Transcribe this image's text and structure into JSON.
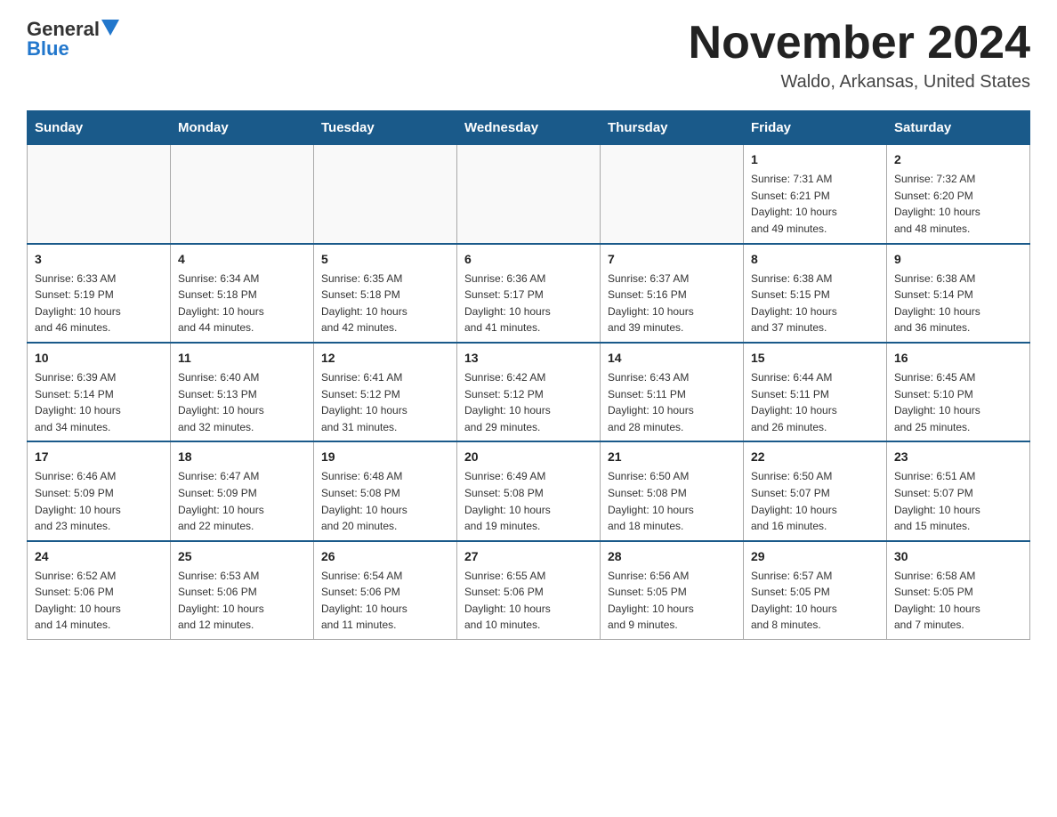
{
  "header": {
    "logo_general": "General",
    "logo_blue": "Blue",
    "main_title": "November 2024",
    "subtitle": "Waldo, Arkansas, United States"
  },
  "days_of_week": [
    "Sunday",
    "Monday",
    "Tuesday",
    "Wednesday",
    "Thursday",
    "Friday",
    "Saturday"
  ],
  "weeks": [
    {
      "days": [
        {
          "number": "",
          "info": ""
        },
        {
          "number": "",
          "info": ""
        },
        {
          "number": "",
          "info": ""
        },
        {
          "number": "",
          "info": ""
        },
        {
          "number": "",
          "info": ""
        },
        {
          "number": "1",
          "info": "Sunrise: 7:31 AM\nSunset: 6:21 PM\nDaylight: 10 hours\nand 49 minutes."
        },
        {
          "number": "2",
          "info": "Sunrise: 7:32 AM\nSunset: 6:20 PM\nDaylight: 10 hours\nand 48 minutes."
        }
      ]
    },
    {
      "days": [
        {
          "number": "3",
          "info": "Sunrise: 6:33 AM\nSunset: 5:19 PM\nDaylight: 10 hours\nand 46 minutes."
        },
        {
          "number": "4",
          "info": "Sunrise: 6:34 AM\nSunset: 5:18 PM\nDaylight: 10 hours\nand 44 minutes."
        },
        {
          "number": "5",
          "info": "Sunrise: 6:35 AM\nSunset: 5:18 PM\nDaylight: 10 hours\nand 42 minutes."
        },
        {
          "number": "6",
          "info": "Sunrise: 6:36 AM\nSunset: 5:17 PM\nDaylight: 10 hours\nand 41 minutes."
        },
        {
          "number": "7",
          "info": "Sunrise: 6:37 AM\nSunset: 5:16 PM\nDaylight: 10 hours\nand 39 minutes."
        },
        {
          "number": "8",
          "info": "Sunrise: 6:38 AM\nSunset: 5:15 PM\nDaylight: 10 hours\nand 37 minutes."
        },
        {
          "number": "9",
          "info": "Sunrise: 6:38 AM\nSunset: 5:14 PM\nDaylight: 10 hours\nand 36 minutes."
        }
      ]
    },
    {
      "days": [
        {
          "number": "10",
          "info": "Sunrise: 6:39 AM\nSunset: 5:14 PM\nDaylight: 10 hours\nand 34 minutes."
        },
        {
          "number": "11",
          "info": "Sunrise: 6:40 AM\nSunset: 5:13 PM\nDaylight: 10 hours\nand 32 minutes."
        },
        {
          "number": "12",
          "info": "Sunrise: 6:41 AM\nSunset: 5:12 PM\nDaylight: 10 hours\nand 31 minutes."
        },
        {
          "number": "13",
          "info": "Sunrise: 6:42 AM\nSunset: 5:12 PM\nDaylight: 10 hours\nand 29 minutes."
        },
        {
          "number": "14",
          "info": "Sunrise: 6:43 AM\nSunset: 5:11 PM\nDaylight: 10 hours\nand 28 minutes."
        },
        {
          "number": "15",
          "info": "Sunrise: 6:44 AM\nSunset: 5:11 PM\nDaylight: 10 hours\nand 26 minutes."
        },
        {
          "number": "16",
          "info": "Sunrise: 6:45 AM\nSunset: 5:10 PM\nDaylight: 10 hours\nand 25 minutes."
        }
      ]
    },
    {
      "days": [
        {
          "number": "17",
          "info": "Sunrise: 6:46 AM\nSunset: 5:09 PM\nDaylight: 10 hours\nand 23 minutes."
        },
        {
          "number": "18",
          "info": "Sunrise: 6:47 AM\nSunset: 5:09 PM\nDaylight: 10 hours\nand 22 minutes."
        },
        {
          "number": "19",
          "info": "Sunrise: 6:48 AM\nSunset: 5:08 PM\nDaylight: 10 hours\nand 20 minutes."
        },
        {
          "number": "20",
          "info": "Sunrise: 6:49 AM\nSunset: 5:08 PM\nDaylight: 10 hours\nand 19 minutes."
        },
        {
          "number": "21",
          "info": "Sunrise: 6:50 AM\nSunset: 5:08 PM\nDaylight: 10 hours\nand 18 minutes."
        },
        {
          "number": "22",
          "info": "Sunrise: 6:50 AM\nSunset: 5:07 PM\nDaylight: 10 hours\nand 16 minutes."
        },
        {
          "number": "23",
          "info": "Sunrise: 6:51 AM\nSunset: 5:07 PM\nDaylight: 10 hours\nand 15 minutes."
        }
      ]
    },
    {
      "days": [
        {
          "number": "24",
          "info": "Sunrise: 6:52 AM\nSunset: 5:06 PM\nDaylight: 10 hours\nand 14 minutes."
        },
        {
          "number": "25",
          "info": "Sunrise: 6:53 AM\nSunset: 5:06 PM\nDaylight: 10 hours\nand 12 minutes."
        },
        {
          "number": "26",
          "info": "Sunrise: 6:54 AM\nSunset: 5:06 PM\nDaylight: 10 hours\nand 11 minutes."
        },
        {
          "number": "27",
          "info": "Sunrise: 6:55 AM\nSunset: 5:06 PM\nDaylight: 10 hours\nand 10 minutes."
        },
        {
          "number": "28",
          "info": "Sunrise: 6:56 AM\nSunset: 5:05 PM\nDaylight: 10 hours\nand 9 minutes."
        },
        {
          "number": "29",
          "info": "Sunrise: 6:57 AM\nSunset: 5:05 PM\nDaylight: 10 hours\nand 8 minutes."
        },
        {
          "number": "30",
          "info": "Sunrise: 6:58 AM\nSunset: 5:05 PM\nDaylight: 10 hours\nand 7 minutes."
        }
      ]
    }
  ]
}
